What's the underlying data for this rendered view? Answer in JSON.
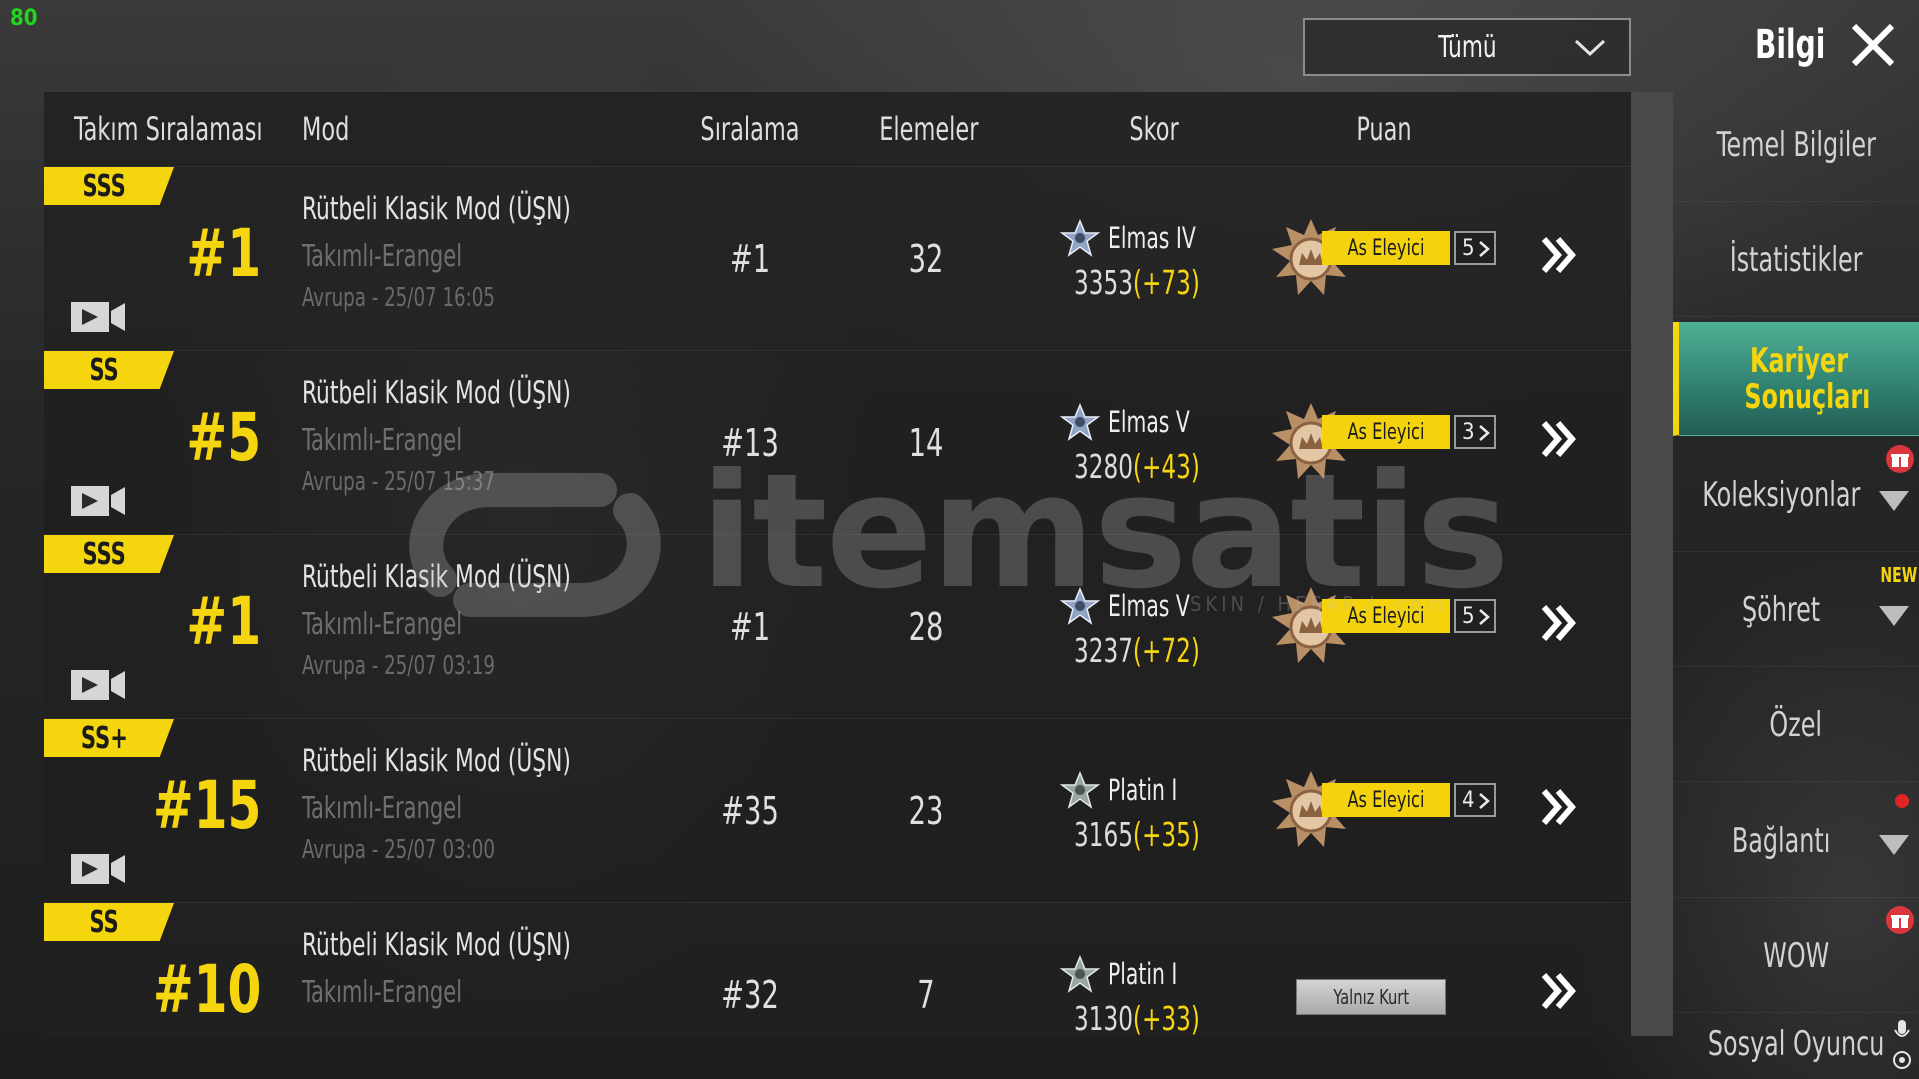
{
  "overlay": {
    "fps": "80"
  },
  "header": {
    "filter_value": "Tümü",
    "title": "Bilgi"
  },
  "columns": {
    "team_rank": "Takım Sıralaması",
    "mode": "Mod",
    "placement": "Sıralama",
    "eliminations": "Elemeler",
    "score": "Skor",
    "points": "Puan"
  },
  "rows": [
    {
      "grade": "SSS",
      "team_rank": "#1",
      "mode": "Rütbeli Klasik Mod (ÜŞN)",
      "map": "Takımlı-Erangel",
      "time": "Avrupa - 25/07 16:05",
      "placement": "#1",
      "eliminations": "32",
      "tier": "Elmas IV",
      "score": "3353",
      "delta": "(+73)",
      "badge": "As Eleyici",
      "badge_count": "5"
    },
    {
      "grade": "SS",
      "team_rank": "#5",
      "mode": "Rütbeli Klasik Mod (ÜŞN)",
      "map": "Takımlı-Erangel",
      "time": "Avrupa - 25/07 15:37",
      "placement": "#13",
      "eliminations": "14",
      "tier": "Elmas V",
      "score": "3280",
      "delta": "(+43)",
      "badge": "As Eleyici",
      "badge_count": "3"
    },
    {
      "grade": "SSS",
      "team_rank": "#1",
      "mode": "Rütbeli Klasik Mod (ÜŞN)",
      "map": "Takımlı-Erangel",
      "time": "Avrupa - 25/07 03:19",
      "placement": "#1",
      "eliminations": "28",
      "tier": "Elmas V",
      "score": "3237",
      "delta": "(+72)",
      "badge": "As Eleyici",
      "badge_count": "5"
    },
    {
      "grade": "SS+",
      "team_rank": "#15",
      "mode": "Rütbeli Klasik Mod (ÜŞN)",
      "map": "Takımlı-Erangel",
      "time": "Avrupa - 25/07 03:00",
      "placement": "#35",
      "eliminations": "23",
      "tier": "Platin I",
      "score": "3165",
      "delta": "(+35)",
      "badge": "As Eleyici",
      "badge_count": "4"
    },
    {
      "grade": "SS",
      "team_rank": "#10",
      "mode": "Rütbeli Klasik Mod (ÜŞN)",
      "map": "Takımlı-Erangel",
      "time": "",
      "placement": "#32",
      "eliminations": "7",
      "tier": "Platin I",
      "score": "3130",
      "delta": "(+33)",
      "badge": "Yalnız Kurt",
      "badge_count": ""
    }
  ],
  "sidebar": {
    "items": [
      {
        "label": "Temel Bilgiler"
      },
      {
        "label": "İstatistikler"
      },
      {
        "label": "Kariyer Sonuçları"
      },
      {
        "label": "Koleksiyonlar"
      },
      {
        "label": "Şöhret"
      },
      {
        "label": "Özel"
      },
      {
        "label": "Bağlantı"
      },
      {
        "label": "WOW"
      },
      {
        "label": "Sosyal Oyuncu"
      }
    ],
    "new_tag": "NEW"
  },
  "watermark": {
    "brand": "itemsatis",
    "tagline": "SKIN / HESAP / .com"
  },
  "colors": {
    "accent": "#f5d50e",
    "active_tab": "#3f9c86",
    "fps": "#22d41f"
  }
}
